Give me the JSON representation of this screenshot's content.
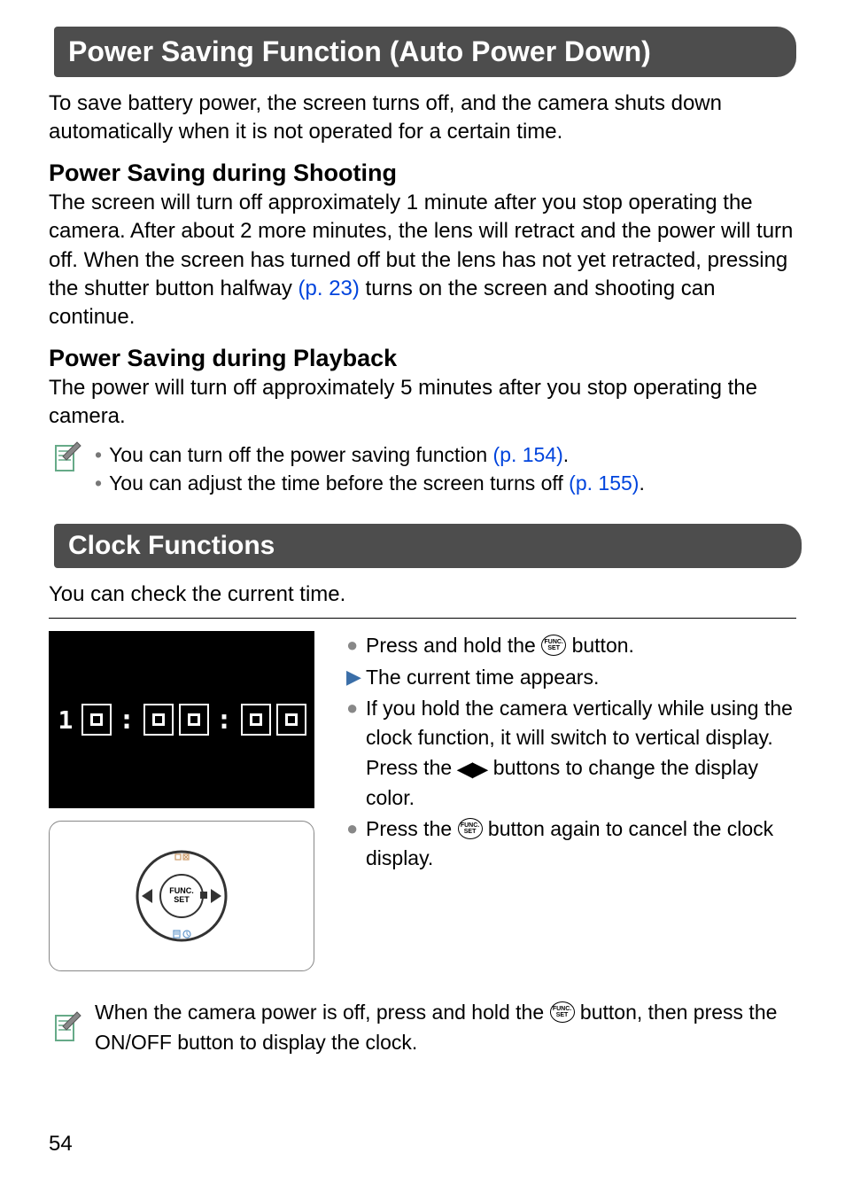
{
  "section1": {
    "title": "Power Saving Function (Auto Power Down)",
    "intro": "To save battery power, the screen turns off, and the camera shuts down automatically when it is not operated for a certain time.",
    "sub1_title": "Power Saving during Shooting",
    "sub1_body_a": "The screen will turn off approximately 1 minute after you stop operating the camera. After about 2 more minutes, the lens will retract and the power will turn off. When the screen has turned off but the lens has not yet retracted, pressing the shutter button halfway ",
    "sub1_link": "(p. 23)",
    "sub1_body_b": " turns on the screen and shooting can continue.",
    "sub2_title": "Power Saving during Playback",
    "sub2_body": "The power will turn off approximately 5 minutes after you stop operating the camera.",
    "note1_a": "You can turn off the power saving function ",
    "note1_link": "(p. 154)",
    "note1_b": ".",
    "note2_a": "You can adjust the time before the screen turns off ",
    "note2_link": "(p. 155)",
    "note2_b": "."
  },
  "section2": {
    "title": "Clock Functions",
    "intro": "You can check the current time.",
    "lcd_digits": [
      "1",
      "0",
      "0",
      "0",
      "0",
      "0"
    ],
    "step1_a": "Press and hold the ",
    "step1_b": " button.",
    "step2": "The current time appears.",
    "step3_a": "If you hold the camera vertically while using the clock function, it will switch to vertical display. Press the ",
    "step3_b": " buttons to change the display color.",
    "step4_a": "Press the ",
    "step4_b": " button again to cancel the clock display.",
    "tip_a": "When the camera power is off, press and hold the ",
    "tip_b": " button, then press the ON/OFF button to display the clock."
  },
  "icons": {
    "func_top": "FUNC.",
    "func_bot": "SET",
    "lr": "◀▶"
  },
  "page_number": "54"
}
